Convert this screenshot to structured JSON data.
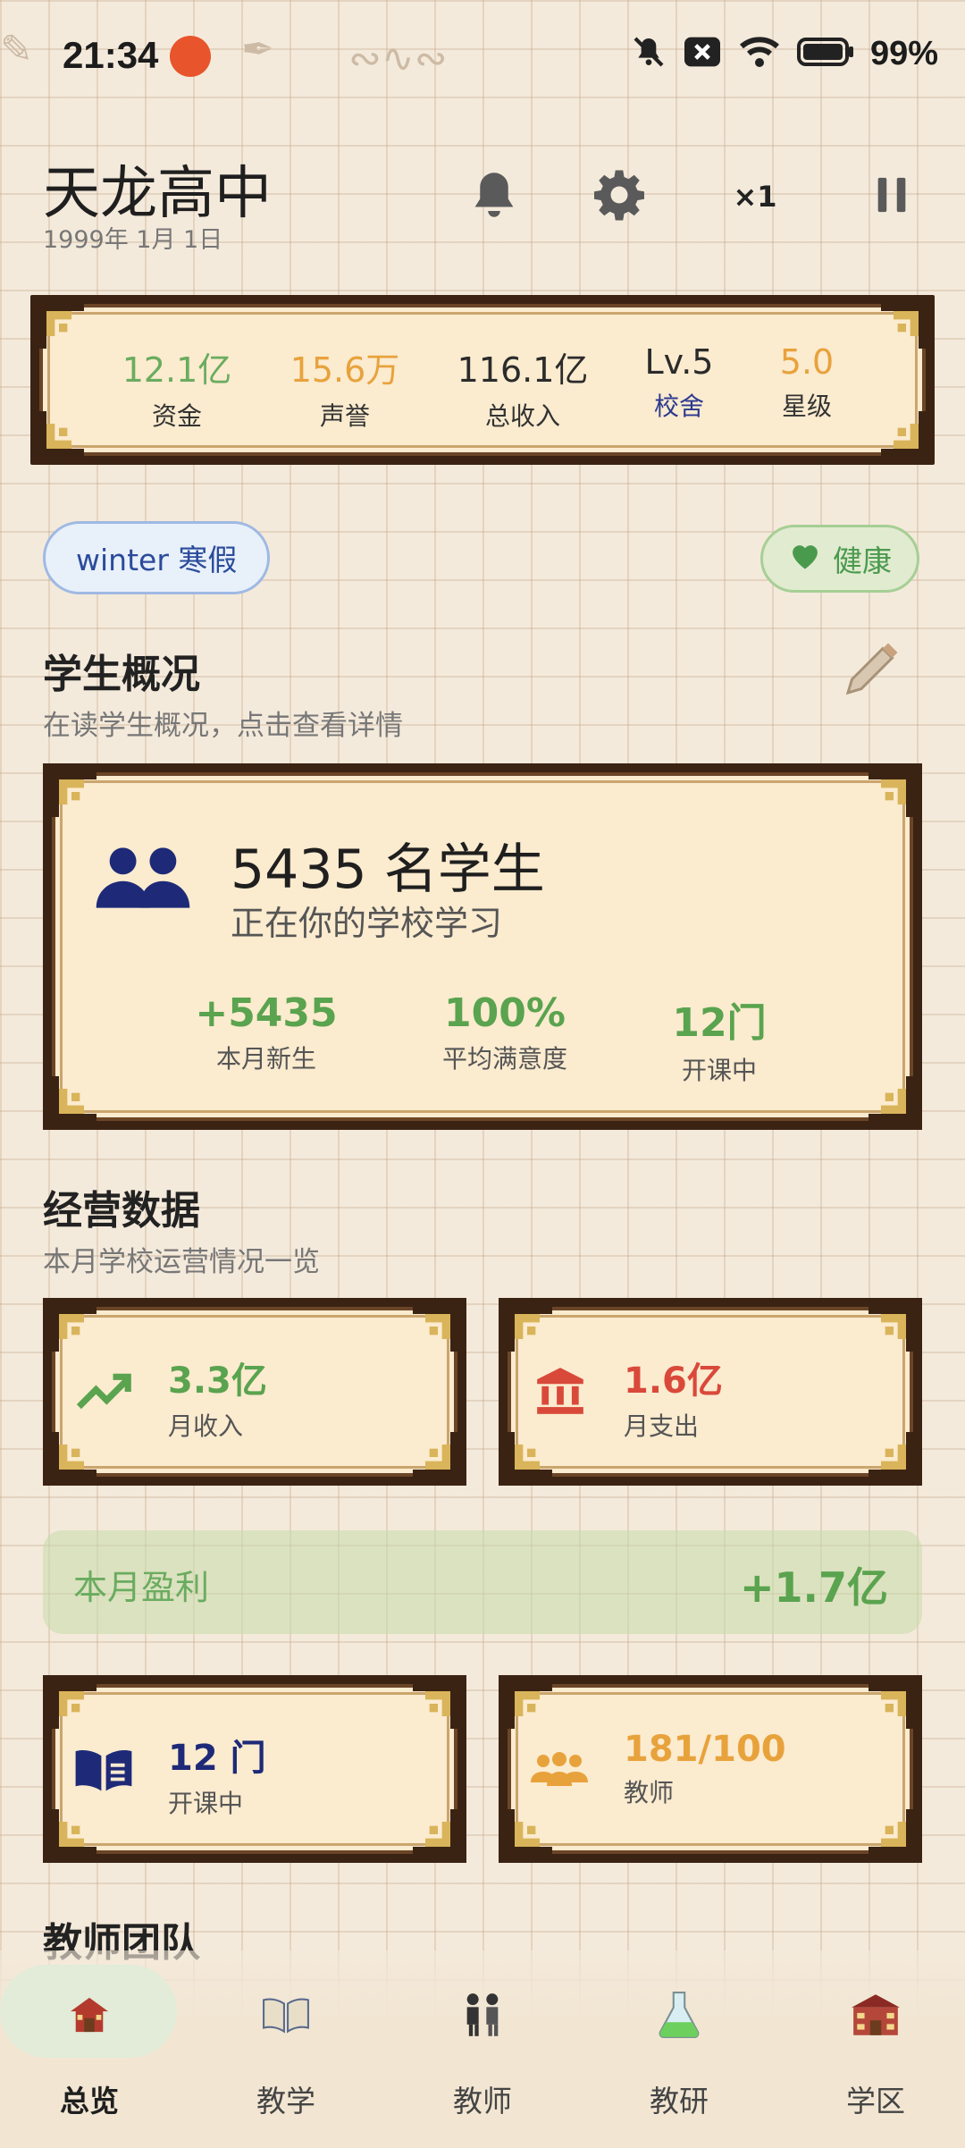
{
  "status": {
    "time": "21:34",
    "battery": "99%"
  },
  "header": {
    "school_name": "天龙高中",
    "date": "1999年 1月 1日",
    "speed": "×1"
  },
  "stats": [
    {
      "value": "12.1亿",
      "label": "资金",
      "color": "#6aac5f"
    },
    {
      "value": "15.6万",
      "label": "声誉",
      "color": "#e8a23c"
    },
    {
      "value": "116.1亿",
      "label": "总收入",
      "color": "#2b2b2b"
    },
    {
      "value": "Lv.5",
      "label": "校舍",
      "color": "#2b2b2b"
    },
    {
      "value": "5.0",
      "label": "星级",
      "color": "#e8a23c"
    }
  ],
  "season": {
    "label": "winter 寒假"
  },
  "health": {
    "label": "健康"
  },
  "students_section": {
    "title": "学生概况",
    "subtitle": "在读学生概况，点击查看详情",
    "count": "5435 名学生",
    "desc": "正在你的学校学习",
    "metrics": [
      {
        "value": "+5435",
        "label": "本月新生"
      },
      {
        "value": "100%",
        "label": "平均满意度"
      },
      {
        "value": "12门",
        "label": "开课中"
      }
    ]
  },
  "operations": {
    "title": "经营数据",
    "subtitle": "本月学校运营情况一览",
    "income": {
      "value": "3.3亿",
      "label": "月收入",
      "color": "#5aa34f"
    },
    "expense": {
      "value": "1.6亿",
      "label": "月支出",
      "color": "#d9493a"
    },
    "profit": {
      "label": "本月盈利",
      "value": "+1.7亿"
    },
    "courses": {
      "value": "12 门",
      "label": "开课中",
      "color": "#1e2a78"
    },
    "teachers": {
      "value": "181/100",
      "label": "教师",
      "color": "#e8a23c"
    }
  },
  "teacher_team": {
    "title": "教师团队"
  },
  "nav": [
    {
      "label": "总览",
      "icon": "school-house-icon",
      "active": true
    },
    {
      "label": "教学",
      "icon": "open-book-icon",
      "active": false
    },
    {
      "label": "教师",
      "icon": "teachers-icon",
      "active": false
    },
    {
      "label": "教研",
      "icon": "flask-icon",
      "active": false
    },
    {
      "label": "学区",
      "icon": "campus-building-icon",
      "active": false
    }
  ]
}
